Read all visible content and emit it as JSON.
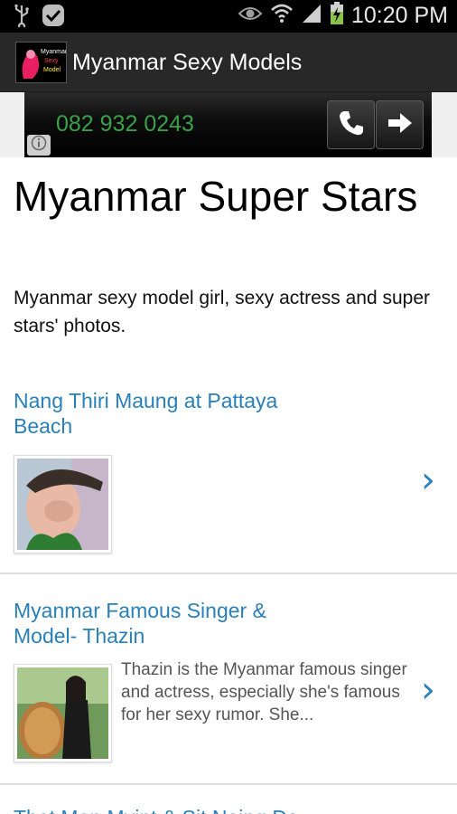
{
  "status_bar": {
    "time": "10:20 PM",
    "icons": [
      "usb-icon",
      "check-icon",
      "eye-icon",
      "wifi-icon",
      "signal-icon",
      "battery-charging-icon"
    ]
  },
  "app": {
    "title": "Myanmar Sexy Models",
    "logo_lines": [
      "Myanmar",
      "Sexy",
      "Model"
    ]
  },
  "ad": {
    "phone": "082 932 0243",
    "call_icon": "phone-icon",
    "go_icon": "arrow-right-icon",
    "info_icon": "info-icon"
  },
  "page": {
    "title": "Myanmar Super Stars",
    "description": "Myanmar sexy model girl, sexy actress and super stars' photos."
  },
  "articles": [
    {
      "title": "Nang Thiri Maung at Pattaya Beach",
      "excerpt": ""
    },
    {
      "title": "Myanmar Famous Singer & Model- Thazin",
      "excerpt": "Thazin is the Myanmar famous singer and actress, especially she's famous for her sexy rumor. She..."
    },
    {
      "title": "That Mon Myint & Sit Naing Da...",
      "excerpt": ""
    }
  ],
  "colors": {
    "link": "#2980b9",
    "ad_phone": "#3aa04a",
    "action_bar": "#282828"
  }
}
